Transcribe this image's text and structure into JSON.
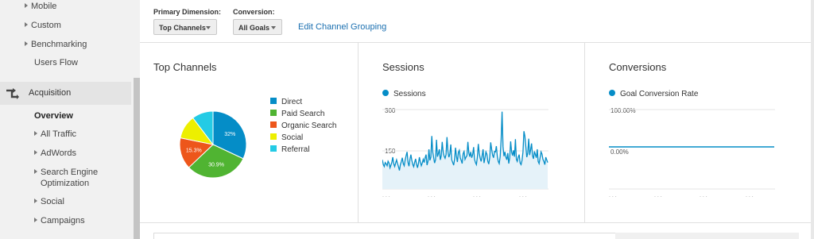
{
  "sidebar": {
    "audience_items": [
      {
        "label": "Mobile",
        "expandable": true
      },
      {
        "label": "Custom",
        "expandable": true
      },
      {
        "label": "Benchmarking",
        "expandable": true
      },
      {
        "label": "Users Flow",
        "expandable": false
      }
    ],
    "section": {
      "label": "Acquisition",
      "icon": "acquisition-icon"
    },
    "acquisition_items": [
      {
        "label": "Overview",
        "expandable": false,
        "active": true
      },
      {
        "label": "All Traffic",
        "expandable": true
      },
      {
        "label": "AdWords",
        "expandable": true
      },
      {
        "label": "Search Engine",
        "label2": "Optimization",
        "expandable": true
      },
      {
        "label": "Social",
        "expandable": true
      },
      {
        "label": "Campaigns",
        "expandable": true
      }
    ]
  },
  "filters": {
    "primary_dimension_label": "Primary Dimension:",
    "primary_dimension_value": "Top Channels",
    "conversion_label": "Conversion:",
    "conversion_value": "All Goals",
    "edit_link": "Edit Channel Grouping"
  },
  "cards": {
    "top_channels": {
      "title": "Top Channels"
    },
    "sessions": {
      "title": "Sessions",
      "legend": "Sessions",
      "y_top": "300",
      "y_mid": "150"
    },
    "conversions": {
      "title": "Conversions",
      "legend": "Goal Conversion Rate",
      "y_top": "100.00%",
      "y_bottom": "0.00%"
    }
  },
  "colors": {
    "direct": "#058dc7",
    "paid_search": "#50b432",
    "organic_search": "#ed561b",
    "social": "#edef00",
    "referral": "#24cbe5",
    "link": "#1a6fb0"
  },
  "chart_data": [
    {
      "type": "pie",
      "title": "Top Channels",
      "categories": [
        "Direct",
        "Paid Search",
        "Organic Search",
        "Social",
        "Referral"
      ],
      "values": [
        32,
        30.9,
        15.3,
        11.5,
        10.3
      ],
      "labels": [
        "32%",
        "30.9%",
        "15.3%",
        "",
        ""
      ],
      "colors": [
        "#058dc7",
        "#50b432",
        "#ed561b",
        "#edef00",
        "#24cbe5"
      ],
      "legend_position": "right"
    },
    {
      "type": "area",
      "title": "Sessions",
      "series": [
        {
          "name": "Sessions",
          "values": [
            110,
            92,
            85,
            100,
            95,
            88,
            105,
            98,
            80,
            90,
            102,
            120,
            95,
            85,
            98,
            110,
            96,
            84,
            70,
            92,
            104,
            118,
            96,
            88,
            110,
            126,
            140,
            100,
            86,
            112,
            130,
            108,
            92,
            84,
            100,
            114,
            94,
            80,
            96,
            120,
            102,
            88,
            98,
            112,
            100,
            118,
            130,
            90,
            104,
            150,
            108,
            120,
            200,
            140,
            118,
            98,
            110,
            186,
            122,
            134,
            150,
            110,
            126,
            178,
            140,
            124,
            116,
            130,
            196,
            142,
            120,
            132,
            168,
            110,
            100,
            90,
            114,
            156,
            124,
            102,
            138,
            146,
            118,
            108,
            96,
            134,
            142,
            112,
            120,
            126,
            178,
            136,
            122,
            140,
            118,
            130,
            158,
            112,
            100,
            92,
            120,
            170,
            134,
            116,
            104,
            126,
            150,
            98,
            118,
            140,
            132,
            104,
            94,
            120,
            176,
            150,
            128,
            118,
            142,
            140,
            162,
            124,
            104,
            96,
            122,
            186,
            292,
            160,
            124,
            140,
            120,
            110,
            136,
            96,
            118,
            180,
            140,
            126,
            146,
            122,
            188,
            112,
            104,
            120,
            130,
            98,
            92,
            108,
            140,
            218,
            200,
            160,
            120,
            136,
            190,
            128,
            148,
            172,
            126,
            114,
            142,
            130,
            118,
            150,
            104,
            96,
            118,
            140,
            132,
            112,
            104,
            92,
            120,
            110,
            100
          ]
        }
      ],
      "ylim": [
        0,
        300
      ],
      "y_ticks": [
        "300",
        "150"
      ],
      "fill": "#e5f2f9",
      "line": "#058dc7"
    },
    {
      "type": "line",
      "title": "Conversions",
      "series": [
        {
          "name": "Goal Conversion Rate",
          "values": [
            0,
            0,
            0,
            0,
            0,
            0,
            0,
            0
          ]
        }
      ],
      "ylim": [
        0,
        100
      ],
      "y_ticks": [
        "100.00%",
        "0.00%"
      ],
      "line": "#058dc7"
    }
  ]
}
